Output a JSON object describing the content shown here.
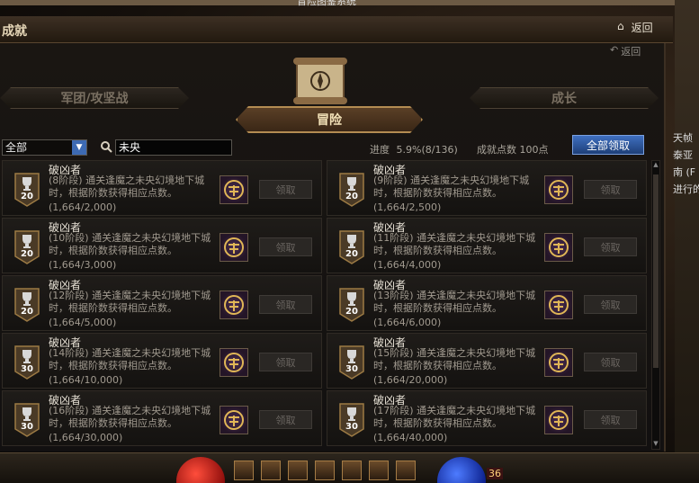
{
  "top_strip_text": "冒险图鉴系统",
  "window": {
    "title": "成就",
    "home_label": "返回",
    "sub_back_label": "返回"
  },
  "categories": {
    "left": "军团/攻坚战",
    "active": "冒险",
    "right": "成长"
  },
  "filter": {
    "selected": "全部",
    "search_value": "未央"
  },
  "progress": {
    "label": "进度",
    "percent": "5.9%",
    "count": "(8/136)",
    "points_label": "成就点数",
    "points_value": "100点"
  },
  "claim_all_label": "全部领取",
  "claim_label": "领取",
  "achievements": [
    {
      "title": "破凶者",
      "desc": "(8阶段) 通关逢魔之未央幻境地下城时，根据阶数获得相应点数。",
      "progress": "(1,664/2,000)",
      "level": "20"
    },
    {
      "title": "破凶者",
      "desc": "(9阶段) 通关逢魔之未央幻境地下城时，根据阶数获得相应点数。",
      "progress": "(1,664/2,500)",
      "level": "20"
    },
    {
      "title": "破凶者",
      "desc": "(10阶段) 通关逢魔之未央幻境地下城时，根据阶数获得相应点数。",
      "progress": "(1,664/3,000)",
      "level": "20"
    },
    {
      "title": "破凶者",
      "desc": "(11阶段) 通关逢魔之未央幻境地下城时，根据阶数获得相应点数。",
      "progress": "(1,664/4,000)",
      "level": "20"
    },
    {
      "title": "破凶者",
      "desc": "(12阶段) 通关逢魔之未央幻境地下城时，根据阶数获得相应点数。",
      "progress": "(1,664/5,000)",
      "level": "20"
    },
    {
      "title": "破凶者",
      "desc": "(13阶段) 通关逢魔之未央幻境地下城时，根据阶数获得相应点数。",
      "progress": "(1,664/6,000)",
      "level": "20"
    },
    {
      "title": "破凶者",
      "desc": "(14阶段) 通关逢魔之未央幻境地下城时，根据阶数获得相应点数。",
      "progress": "(1,664/10,000)",
      "level": "30"
    },
    {
      "title": "破凶者",
      "desc": "(15阶段) 通关逢魔之未央幻境地下城时，根据阶数获得相应点数。",
      "progress": "(1,664/20,000)",
      "level": "30"
    },
    {
      "title": "破凶者",
      "desc": "(16阶段) 通关逢魔之未央幻境地下城时，根据阶数获得相应点数。",
      "progress": "(1,664/30,000)",
      "level": "30"
    },
    {
      "title": "破凶者",
      "desc": "(17阶段) 通关逢魔之未央幻境地下城时，根据阶数获得相应点数。",
      "progress": "(1,664/40,000)",
      "level": "30"
    }
  ],
  "side_chat": [
    "天帧",
    "泰亚",
    "",
    "南 (F",
    "进行的"
  ],
  "hotbar": {
    "count": "36"
  },
  "colors": {
    "accent": "#b38c52",
    "claim_all": "#2f5aa8"
  }
}
